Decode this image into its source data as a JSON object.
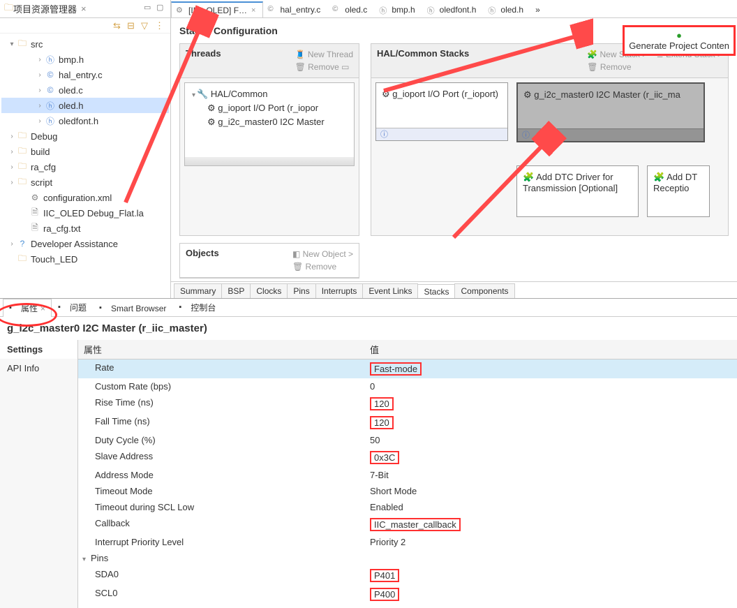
{
  "project_explorer": {
    "title": "项目资源管理器",
    "tree": [
      {
        "d": 1,
        "exp": "▾",
        "icon": "folder",
        "label": "src"
      },
      {
        "d": 3,
        "exp": "›",
        "icon": "h",
        "label": "bmp.h"
      },
      {
        "d": 3,
        "exp": "›",
        "icon": "c",
        "label": "hal_entry.c"
      },
      {
        "d": 3,
        "exp": "›",
        "icon": "c",
        "label": "oled.c"
      },
      {
        "d": 3,
        "exp": "›",
        "icon": "h",
        "label": "oled.h",
        "selected": true
      },
      {
        "d": 3,
        "exp": "›",
        "icon": "h",
        "label": "oledfont.h"
      },
      {
        "d": 1,
        "exp": "›",
        "icon": "folder",
        "label": "Debug"
      },
      {
        "d": 1,
        "exp": "›",
        "icon": "folder",
        "label": "build"
      },
      {
        "d": 1,
        "exp": "›",
        "icon": "folder",
        "label": "ra_cfg"
      },
      {
        "d": 1,
        "exp": "›",
        "icon": "folder",
        "label": "script"
      },
      {
        "d": 2,
        "exp": "",
        "icon": "gear",
        "label": "configuration.xml"
      },
      {
        "d": 2,
        "exp": "",
        "icon": "txt",
        "label": "IIC_OLED Debug_Flat.la"
      },
      {
        "d": 2,
        "exp": "",
        "icon": "txt",
        "label": "ra_cfg.txt"
      },
      {
        "d": 1,
        "exp": "›",
        "icon": "help",
        "label": "Developer Assistance"
      },
      {
        "d": 1,
        "exp": "",
        "icon": "folder",
        "label": "Touch_LED"
      }
    ]
  },
  "editor_tabs": [
    {
      "label": "[IIC_OLED] F…",
      "icon": "gear",
      "active": true,
      "closable": true
    },
    {
      "label": "hal_entry.c",
      "icon": "c",
      "active": false
    },
    {
      "label": "oled.c",
      "icon": "c",
      "active": false
    },
    {
      "label": "bmp.h",
      "icon": "h",
      "active": false
    },
    {
      "label": "oledfont.h",
      "icon": "h",
      "active": false
    },
    {
      "label": "oled.h",
      "icon": "h",
      "active": false
    }
  ],
  "stacks": {
    "title": "Stacks Configuration",
    "generate_label": "Generate Project Conten",
    "threads": {
      "title": "Threads",
      "actions": {
        "new": "New Thread",
        "remove": "Remove"
      },
      "root": "HAL/Common",
      "children": [
        "g_ioport I/O Port (r_iopor",
        "g_i2c_master0 I2C Master"
      ]
    },
    "objects": {
      "title": "Objects",
      "actions": {
        "new": "New Object >",
        "remove": "Remove"
      }
    },
    "hal": {
      "title": "HAL/Common Stacks",
      "actions": {
        "new": "New Stack >",
        "extend": "Extend Stack >",
        "remove": "Remove"
      },
      "boxes": [
        {
          "label": "g_ioport I/O Port (r_ioport)",
          "selected": false
        },
        {
          "label": "g_i2c_master0 I2C Master (r_iic_ma",
          "selected": true
        }
      ],
      "subboxes": [
        {
          "label": "Add DTC Driver for Transmission [Optional]"
        },
        {
          "label": "Add DT Receptio"
        }
      ]
    },
    "bottom_tabs": [
      "Summary",
      "BSP",
      "Clocks",
      "Pins",
      "Interrupts",
      "Event Links",
      "Stacks",
      "Components"
    ],
    "bottom_active": "Stacks"
  },
  "bottom_panel": {
    "tabs": [
      {
        "label": "属性",
        "active": true,
        "closable": true
      },
      {
        "label": "问题",
        "active": false
      },
      {
        "label": "Smart Browser",
        "active": false
      },
      {
        "label": "控制台",
        "active": false
      }
    ],
    "module_title": "g_i2c_master0 I2C Master (r_iic_master)",
    "side": [
      {
        "label": "Settings",
        "active": true
      },
      {
        "label": "API Info",
        "active": false
      }
    ],
    "columns": {
      "prop": "属性",
      "value": "值"
    },
    "rows": [
      {
        "k": "Rate",
        "v": "Fast-mode",
        "hl": true,
        "box": true,
        "indent": 1
      },
      {
        "k": "Custom Rate (bps)",
        "v": "0",
        "indent": 1
      },
      {
        "k": "Rise Time (ns)",
        "v": "120",
        "box": true,
        "indent": 1
      },
      {
        "k": "Fall Time (ns)",
        "v": "120",
        "box": true,
        "indent": 1
      },
      {
        "k": "Duty Cycle (%)",
        "v": "50",
        "indent": 1
      },
      {
        "k": "Slave Address",
        "v": "0x3C",
        "box": true,
        "indent": 1
      },
      {
        "k": "Address Mode",
        "v": "7-Bit",
        "indent": 1
      },
      {
        "k": "Timeout Mode",
        "v": "Short Mode",
        "indent": 1
      },
      {
        "k": "Timeout during SCL Low",
        "v": "Enabled",
        "indent": 1
      },
      {
        "k": "Callback",
        "v": "IIC_master_callback",
        "box": true,
        "indent": 1
      },
      {
        "k": "Interrupt Priority Level",
        "v": "Priority 2",
        "indent": 1
      },
      {
        "k": "Pins",
        "v": "",
        "indent": 0,
        "expander": "▾"
      },
      {
        "k": "SDA0",
        "v": "P401",
        "box": true,
        "indent": 1
      },
      {
        "k": "SCL0",
        "v": "P400",
        "box": true,
        "indent": 1
      }
    ]
  }
}
